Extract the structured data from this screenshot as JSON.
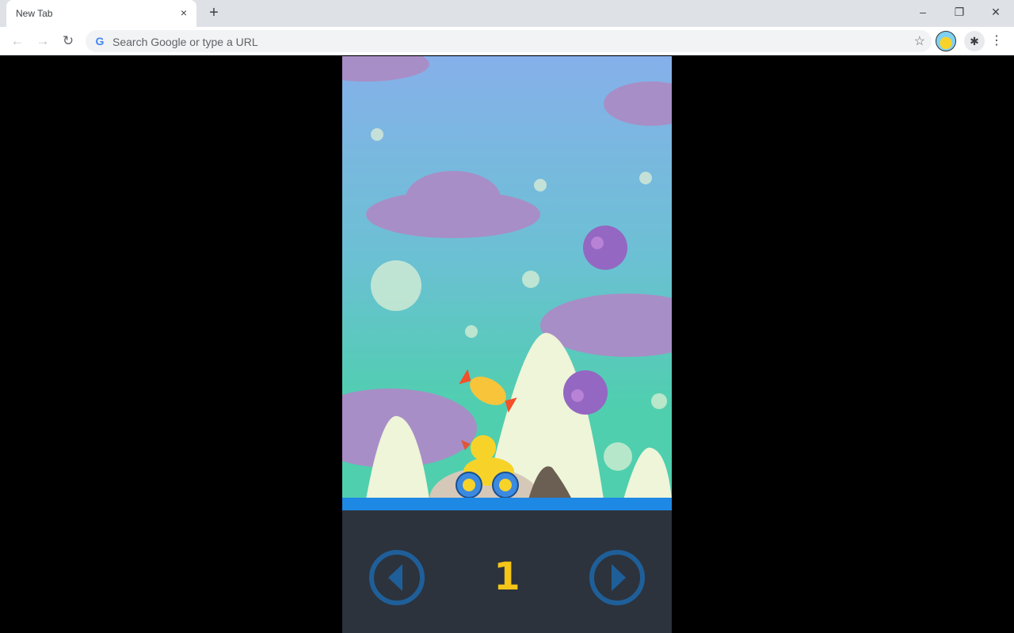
{
  "browser": {
    "tab_title": "New Tab",
    "tab_close_icon": "×",
    "new_tab_icon": "+",
    "omnibox_placeholder": "Search Google or type a URL",
    "window_controls": {
      "minimize": "–",
      "restore": "❐",
      "close": "✕"
    },
    "nav": {
      "back": "←",
      "forward": "→",
      "reload": "↻"
    },
    "bookmark_icon": "☆",
    "extensions_icon": "✱",
    "menu_icon": "⋮"
  },
  "game": {
    "level": "1",
    "colors": {
      "sky_top": "#86b0ea",
      "sky_bottom": "#4fcfae",
      "cloud": "#a88ec6",
      "ground": "#1e88e5",
      "panel": "#2c333d",
      "button": "#1f5f99",
      "level_text": "#f5c518"
    },
    "controls": {
      "left": "left-arrow",
      "right": "right-arrow"
    }
  }
}
